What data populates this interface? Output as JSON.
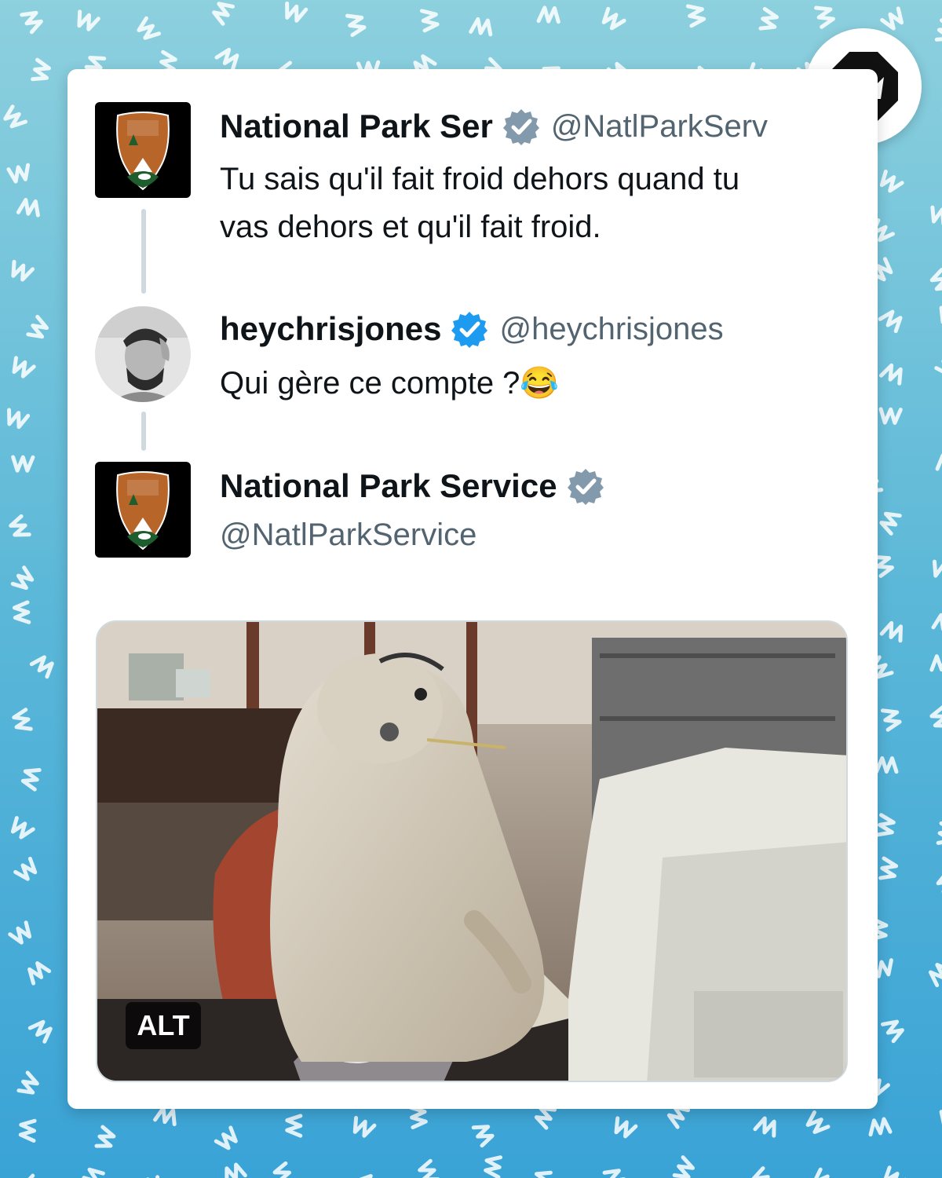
{
  "colors": {
    "background": "#5cb8d8",
    "card": "#ffffff",
    "name": "#0f1419",
    "handle": "#536471",
    "verified_grey": "#829aab",
    "verified_blue": "#1d9bf0"
  },
  "badge": {
    "icon": "crown-icon"
  },
  "tweets": [
    {
      "name": "National Park Ser",
      "handle": "@NatlParkServ",
      "verified": "grey",
      "avatar": "nps-arrowhead-logo",
      "text_lines": [
        "Tu sais qu'il fait froid dehors quand tu",
        "vas dehors et qu'il fait froid."
      ]
    },
    {
      "name": "heychrisjones",
      "handle": "@heychrisjones",
      "verified": "blue",
      "avatar": "profile-photo",
      "text": "Qui gère ce compte ?😂"
    },
    {
      "name": "National Park Service",
      "handle": "@NatlParkService",
      "verified": "grey",
      "avatar": "nps-arrowhead-logo",
      "media": {
        "alt_label": "ALT",
        "subject": "prairie-dog-at-computer-photo"
      }
    }
  ]
}
